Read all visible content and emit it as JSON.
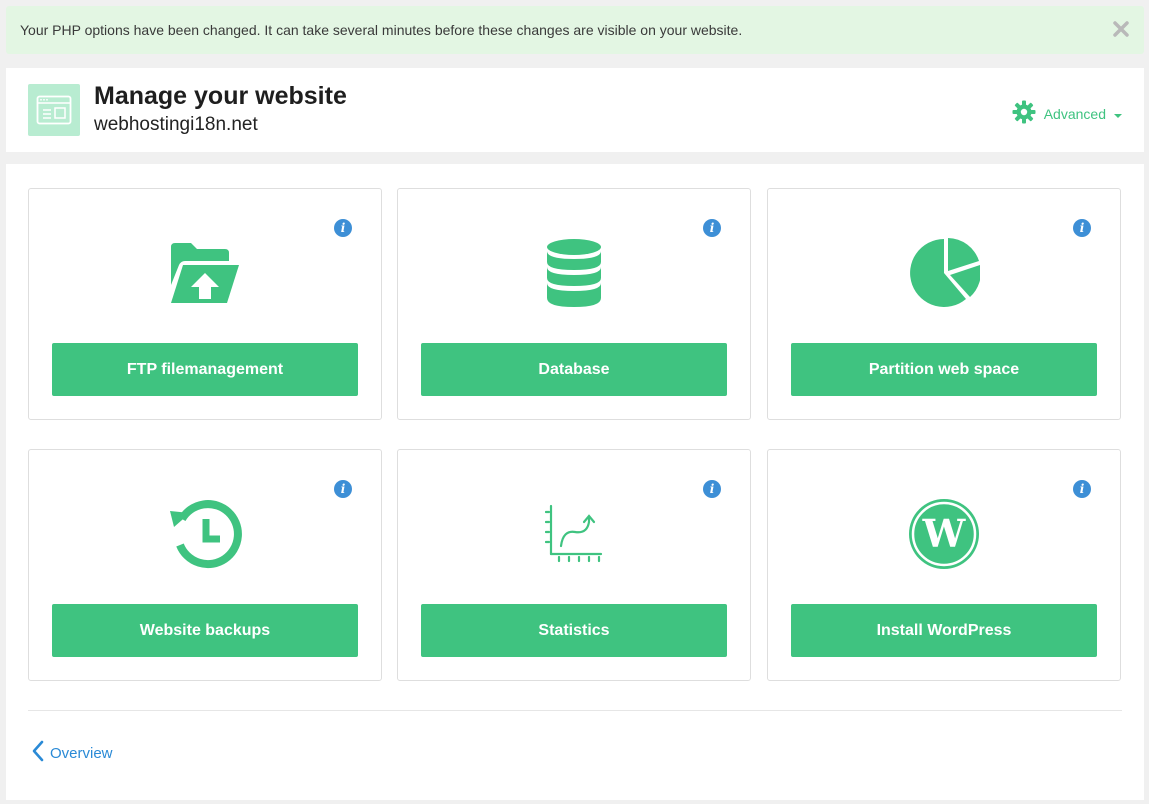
{
  "notice": {
    "message": "Your PHP options have been changed. It can take several minutes before these changes are visible on your website."
  },
  "header": {
    "title": "Manage your website",
    "domain": "webhostingi18n.net",
    "advanced_label": "Advanced"
  },
  "cards": [
    {
      "label": "FTP filemanagement",
      "icon": "folder-upload-icon"
    },
    {
      "label": "Database",
      "icon": "database-icon"
    },
    {
      "label": "Partition web space",
      "icon": "pie-chart-icon"
    },
    {
      "label": "Website backups",
      "icon": "history-clock-icon"
    },
    {
      "label": "Statistics",
      "icon": "line-chart-icon"
    },
    {
      "label": "Install WordPress",
      "icon": "wordpress-icon"
    }
  ],
  "footer": {
    "overview_label": "Overview"
  },
  "colors": {
    "accent": "#3fc380",
    "info": "#3d8fd6",
    "link": "#2a8ad6",
    "notice_bg": "#e3f6e3"
  }
}
